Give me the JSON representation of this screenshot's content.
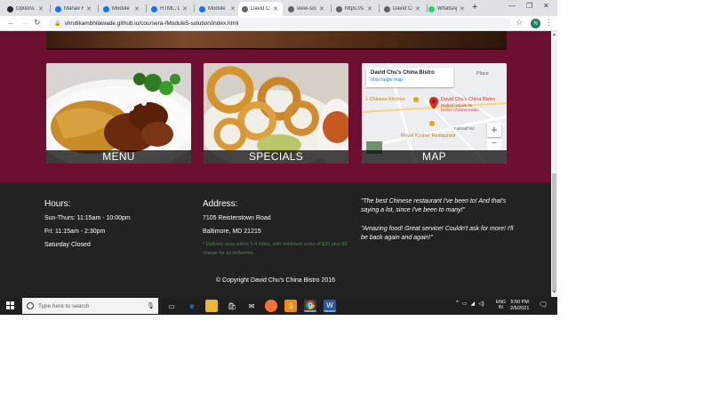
{
  "browser": {
    "tabs": [
      {
        "title": "Options",
        "favicon_color": "#24292e",
        "active": false
      },
      {
        "title": "Manav R",
        "favicon_color": "#1a73e8",
        "active": false
      },
      {
        "title": "Module",
        "favicon_color": "#1a73e8",
        "active": false
      },
      {
        "title": "HTML, C",
        "favicon_color": "#1a73e8",
        "active": false
      },
      {
        "title": "Module",
        "favicon_color": "#1a73e8",
        "active": false
      },
      {
        "title": "David Ch",
        "favicon_color": "#5f6368",
        "active": true
      },
      {
        "title": "view-sou",
        "favicon_color": "#5f6368",
        "active": false
      },
      {
        "title": "https://s",
        "favicon_color": "#5f6368",
        "active": false
      },
      {
        "title": "David Ch",
        "favicon_color": "#5f6368",
        "active": false
      },
      {
        "title": "WhatsAp",
        "favicon_color": "#25d366",
        "active": false
      }
    ],
    "new_tab": "+",
    "url": "shrutikambhilawade.github.io/coursera-/Module5-solution/index.html",
    "profile_initial": "N"
  },
  "page": {
    "tiles": {
      "menu": "MENU",
      "specials": "SPECIALS",
      "map": "MAP"
    },
    "map": {
      "place_title": "David Chu's China Bistro",
      "view_larger": "View larger map",
      "place_type": "Place",
      "pin_title": "David Chu's China Bistro",
      "pin_subtitle_1": "Modest outpost for",
      "pin_subtitle_2": "kosher Chinese meals",
      "kitchen_label": "1 Chinese Kitchen",
      "kosher_label": "Royal Kosher Restaurant",
      "road_label": "Fallstaff Rd",
      "zoom_in": "+",
      "zoom_out": "−"
    },
    "footer": {
      "hours_heading": "Hours:",
      "hours_1": "Sun-Thurs: 11:15am - 10:00pm",
      "hours_2": "Fri: 11:15am - 2:30pm",
      "hours_3": "Saturday Closed",
      "address_heading": "Address:",
      "address_1": "7105 Reisterstown Road",
      "address_2": "Baltimore, MD 21215",
      "delivery_note": "* Delivery area within 3-4 miles, with minimum order of $20 plus $3 charge for all deliveries.",
      "quote_1": "\"The best Chinese restaurant I've been to! And that's saying a lot, since I've been to many!\"",
      "quote_2": "\"Amazing food! Great service! Couldn't ask for more! I'll be back again and again!\"",
      "copyright": "© Copyright David Chu's China Bistro 2016"
    }
  },
  "taskbar": {
    "search_placeholder": "Type here to search",
    "lang_1": "ENG",
    "lang_2": "IN",
    "time": "5:50 PM",
    "date": "2/5/2021"
  }
}
